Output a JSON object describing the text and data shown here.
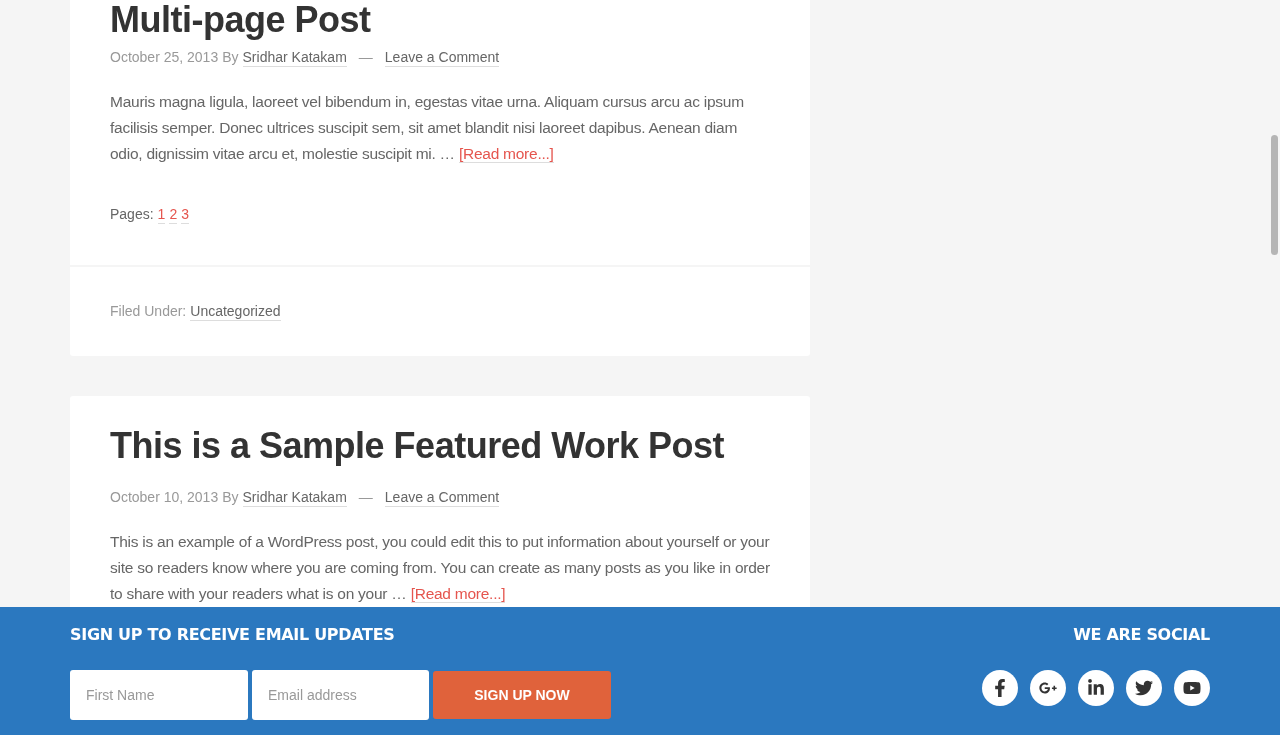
{
  "posts": [
    {
      "title": "Multi-page Post",
      "date": "October 25, 2013",
      "by": "By",
      "author": "Sridhar Katakam",
      "separator": "—",
      "comments": "Leave a Comment",
      "excerpt": "Mauris magna ligula, laoreet vel bibendum in, egestas vitae urna. Aliquam cursus arcu ac ipsum facilisis semper. Donec ultrices suscipit sem, sit amet blandit nisi laoreet dapibus. Aenean diam odio, dignissim vitae arcu et, molestie suscipit mi. …",
      "read_more": "[Read more...]",
      "pages_label": "Pages:",
      "pages": [
        "1",
        "2",
        "3"
      ],
      "filed_label": "Filed Under:",
      "category": "Uncategorized"
    },
    {
      "title": "This is a Sample Featured Work Post",
      "date": "October 10, 2013",
      "by": "By",
      "author": "Sridhar Katakam",
      "separator": "—",
      "comments": "Leave a Comment",
      "excerpt": "This is an example of a WordPress post, you could edit this to put information about yourself or your site so readers know where you are coming from. You can create as many posts as you like in order to share with your readers what is on your …",
      "read_more": "[Read more...]"
    }
  ],
  "footer": {
    "signup_title": "SIGN UP TO RECEIVE EMAIL UPDATES",
    "first_name": {
      "placeholder": "First Name"
    },
    "email": {
      "placeholder": "Email address"
    },
    "button": "SIGN UP NOW",
    "social_title": "WE ARE SOCIAL",
    "social": [
      {
        "kind": "facebook"
      },
      {
        "kind": "googleplus"
      },
      {
        "kind": "linkedin"
      },
      {
        "kind": "twitter"
      },
      {
        "kind": "youtube"
      }
    ]
  }
}
